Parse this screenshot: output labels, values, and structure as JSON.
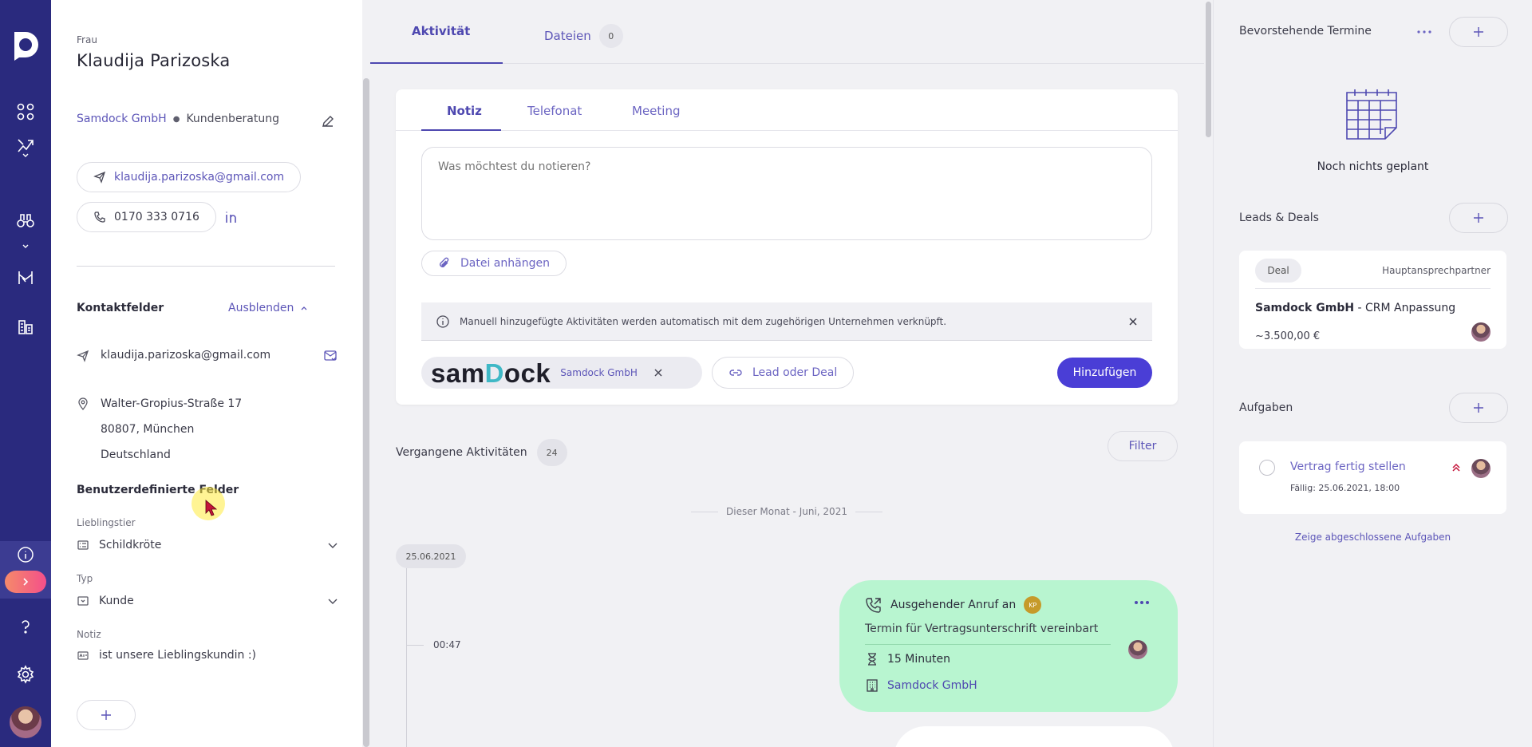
{
  "contact": {
    "salutation": "Frau",
    "name": "Klaudija Parizoska",
    "company": "Samdock GmbH",
    "department": "Kundenberatung",
    "email": "klaudija.parizoska@gmail.com",
    "phone": "0170 333 0716"
  },
  "contact_fields": {
    "title": "Kontaktfelder",
    "toggle_label": "Ausblenden",
    "email": "klaudija.parizoska@gmail.com",
    "address_line1": "Walter-Gropius-Straße 17",
    "address_line2": "80807, München",
    "address_line3": "Deutschland"
  },
  "custom_fields": {
    "title": "Benutzerdefinierte Felder",
    "favorite_label": "Lieblingstier",
    "favorite_value": "Schildkröte",
    "type_label": "Typ",
    "type_value": "Kunde",
    "note_label": "Notiz",
    "note_value": "ist unsere Lieblingskundin :)"
  },
  "main_tabs": {
    "activity": "Aktivität",
    "files": "Dateien",
    "files_count": "0"
  },
  "composer": {
    "tab_note": "Notiz",
    "tab_call": "Telefonat",
    "tab_meeting": "Meeting",
    "placeholder": "Was möchtest du notieren?",
    "attach_label": "Datei anhängen",
    "info_text": "Manuell hinzugefügte Aktivitäten werden automatisch mit dem zugehörigen Unternehmen verknüpft.",
    "company_logo_word_a": "sam",
    "company_logo_word_o": "D",
    "company_logo_word_b": "ock",
    "company_chip": "Samdock GmbH",
    "lead_label": "Lead oder Deal",
    "submit_label": "Hinzufügen"
  },
  "past": {
    "title": "Vergangene Aktivitäten",
    "count": "24",
    "filter_label": "Filter",
    "month_separator": "Dieser Monat - Juni, 2021",
    "date": "25.06.2021",
    "time": "00:47",
    "call_title": "Ausgehender Anruf an",
    "call_initials": "KP",
    "call_subject": "Termin für Vertragsunterschrift vereinbart",
    "call_duration": "15 Minuten",
    "call_company": "Samdock GmbH"
  },
  "right": {
    "appointments_title": "Bevorstehende Termine",
    "appointments_empty": "Noch nichts geplant",
    "deals_title": "Leads & Deals",
    "deal_tag": "Deal",
    "deal_role": "Hauptansprechpartner",
    "deal_company": "Samdock GmbH",
    "deal_name": " - CRM Anpassung",
    "deal_amount": "~3.500,00 €",
    "tasks_title": "Aufgaben",
    "task_title": "Vertrag fertig stellen",
    "task_due": "Fällig: 25.06.2021, 18:00",
    "show_done": "Zeige abgeschlossene Aufgaben"
  },
  "colors": {
    "rail": "#2a2a7e",
    "accent": "#4a3ed6",
    "link": "#5d56b8",
    "call_card": "#b8f5d0"
  }
}
